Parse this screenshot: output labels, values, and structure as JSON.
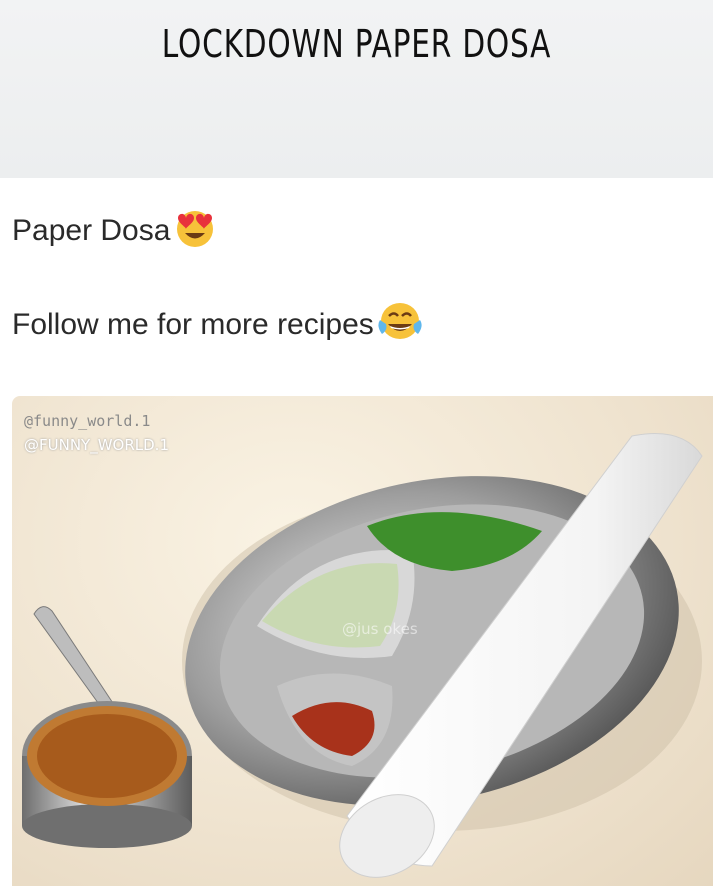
{
  "header": {
    "title": "LOCKDOWN PAPER DOSA"
  },
  "post": {
    "line1": "Paper Dosa",
    "line1_emoji": "heart-eyes-emoji",
    "line2": "Follow me for more recipes",
    "line2_emoji": "tears-of-joy-emoji"
  },
  "photo": {
    "watermark_1": "@funny_world.1",
    "watermark_2": "@FUNNY_WORLD.1",
    "watermark_3": "@jus     okes"
  }
}
